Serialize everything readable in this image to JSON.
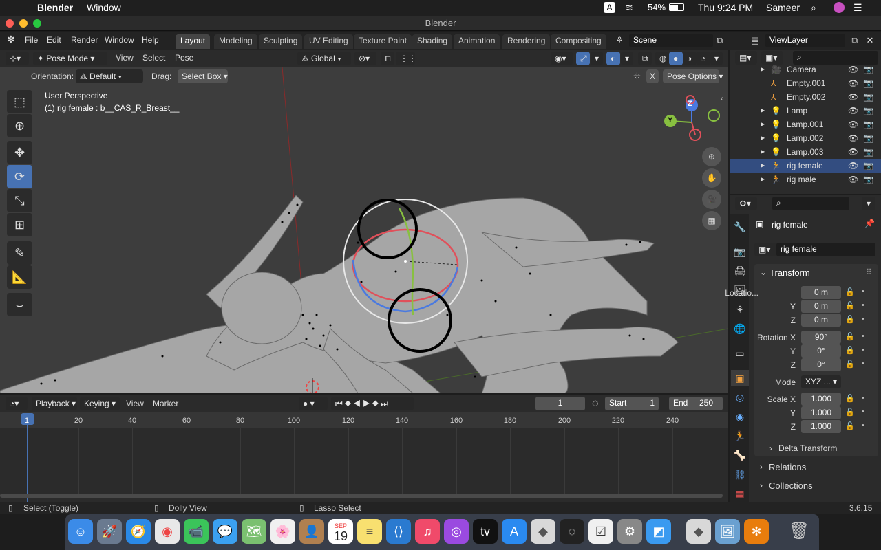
{
  "menubar": {
    "app": "Blender",
    "window": "Window",
    "a_badge": "A",
    "battery": "54%",
    "clock": "Thu 9:24 PM",
    "user": "Sameer"
  },
  "window_title": "Blender",
  "top_menu": [
    "File",
    "Edit",
    "Render",
    "Window",
    "Help"
  ],
  "workspaces": [
    "Layout",
    "Modeling",
    "Sculpting",
    "UV Editing",
    "Texture Paint",
    "Shading",
    "Animation",
    "Rendering",
    "Compositing"
  ],
  "scene": "Scene",
  "view_layer": "ViewLayer",
  "viewport_header": {
    "mode": "Pose Mode",
    "menus": [
      "View",
      "Select",
      "Pose"
    ],
    "transform_orientation": "Global"
  },
  "tool_header": {
    "orientation_label": "Orientation:",
    "orientation_value": "Default",
    "drag_label": "Drag:",
    "drag_value": "Select Box",
    "pose_options": "Pose Options"
  },
  "overlay_text": {
    "perspective": "User Perspective",
    "active": "(1) rig female : b__CAS_R_Breast__"
  },
  "gizmo_axes": {
    "z": "Z",
    "y": "Y"
  },
  "timeline": {
    "menus": [
      "Playback",
      "Keying",
      "View",
      "Marker"
    ],
    "current_frame": "1",
    "start_label": "Start",
    "start": "1",
    "end_label": "End",
    "end": "250",
    "ruler": [
      "1",
      "20",
      "40",
      "60",
      "80",
      "100",
      "120",
      "140",
      "160",
      "180",
      "200",
      "220",
      "240"
    ]
  },
  "outliner": {
    "items": [
      {
        "name": "Camera",
        "icon": "camera-icon"
      },
      {
        "name": "Empty.001",
        "icon": "empty-icon"
      },
      {
        "name": "Empty.002",
        "icon": "empty-icon"
      },
      {
        "name": "Lamp",
        "icon": "lamp-icon"
      },
      {
        "name": "Lamp.001",
        "icon": "lamp-icon"
      },
      {
        "name": "Lamp.002",
        "icon": "lamp-icon"
      },
      {
        "name": "Lamp.003",
        "icon": "lamp-icon"
      },
      {
        "name": "rig female",
        "icon": "armature-icon",
        "selected": true
      },
      {
        "name": "rig male",
        "icon": "armature-icon"
      }
    ]
  },
  "properties": {
    "object_name": "rig female",
    "datablock": "rig female",
    "transform_header": "Transform",
    "location": {
      "label": "Locatio...",
      "x": "0 m",
      "y": "0 m",
      "z": "0 m"
    },
    "rotation": {
      "label": "Rotation X",
      "x": "90°",
      "y": "0°",
      "z": "0°"
    },
    "mode": {
      "label": "Mode",
      "value": "XYZ ..."
    },
    "scale": {
      "label": "Scale X",
      "x": "1.000",
      "y": "1.000",
      "z": "1.000"
    },
    "axis_y": "Y",
    "axis_z": "Z",
    "delta": "Delta Transform",
    "relations": "Relations",
    "collections": "Collections"
  },
  "statusbar": {
    "select": "Select (Toggle)",
    "dolly": "Dolly View",
    "lasso": "Lasso Select",
    "version": "3.6.15"
  },
  "dock_calendar": {
    "month": "SEP",
    "day": "19"
  },
  "colors": {
    "accent": "#4772b3",
    "active_ws": "#454545",
    "viewport": "#3d3d3d"
  }
}
